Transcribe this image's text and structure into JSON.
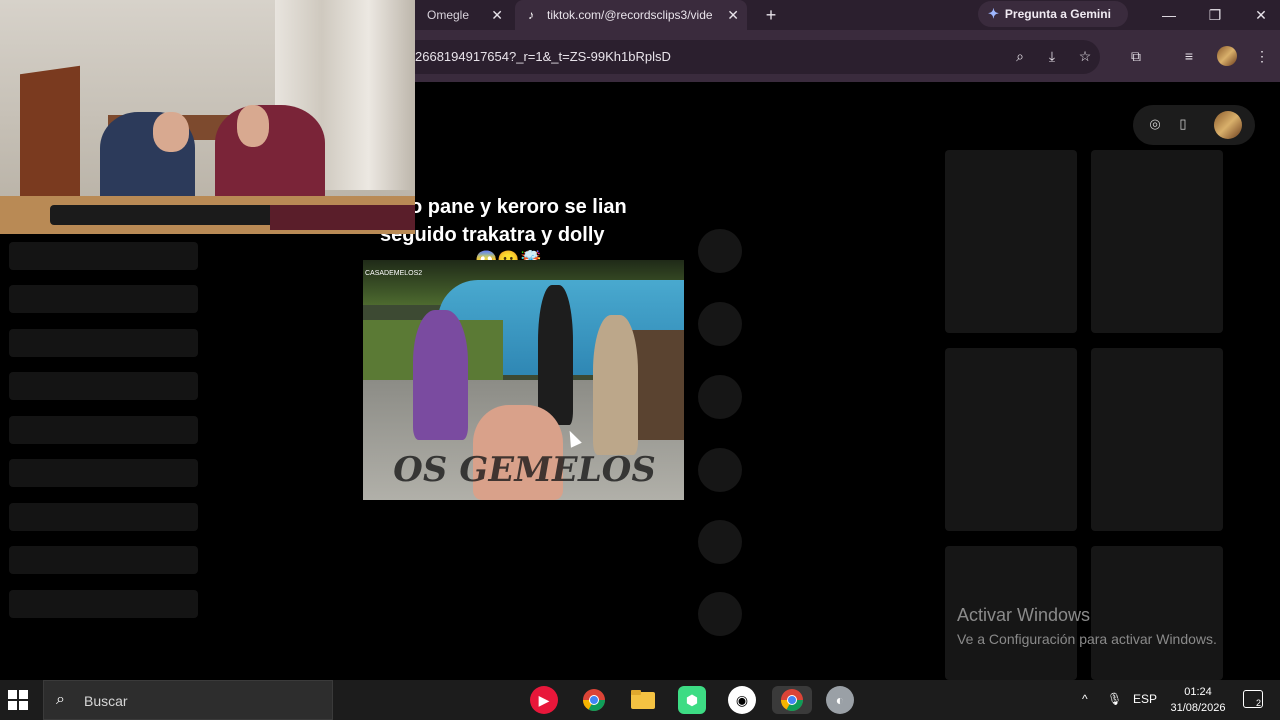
{
  "browser": {
    "tabs": [
      {
        "label": "Omegle",
        "active": false
      },
      {
        "label": "tiktok.com/@recordsclips3/vide",
        "active": true
      }
    ],
    "new_tab_icon": "plus-icon",
    "gemini_label": "Pregunta a Gemini",
    "url": "2668194917654?_r=1&_t=ZS-99Kh1bRplsD",
    "colors": {
      "tabstrip": "#2b1f2e",
      "toolbar": "#3a2b3d"
    }
  },
  "video": {
    "caption_line1": "o pane y keroro se lian",
    "caption_line2": "seguido trakatra y dolly",
    "emojis": "😱😶🤯",
    "channel_tag": "CASADEMELOS2",
    "watermark": "OS GEMELOS"
  },
  "windows_activation": {
    "title": "Activar Windows",
    "subtitle": "Ve a Configuración para activar Windows."
  },
  "taskbar": {
    "search_placeholder": "Buscar",
    "language": "ESP",
    "time": "01:24",
    "date": "31/08/2026",
    "notification_count": "2"
  }
}
